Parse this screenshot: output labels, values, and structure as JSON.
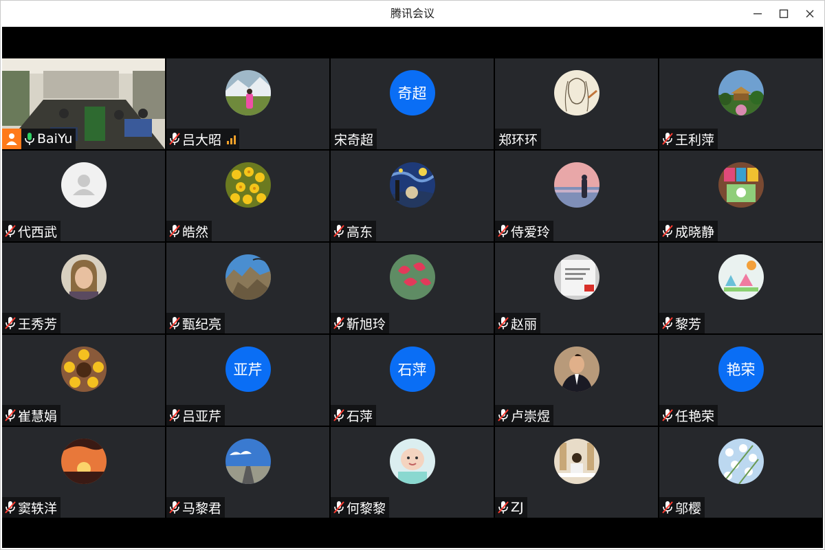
{
  "window": {
    "title": "腾讯会议"
  },
  "colors": {
    "accent_blue": "#0a6ef5",
    "tile_bg": "#26282c",
    "host_orange": "#ff7a1a",
    "signal": "#f2a12a",
    "active_border": "#27c15b"
  },
  "participants": [
    {
      "name": "BaiYu",
      "mic": "on",
      "host": true,
      "video": true,
      "avatar": "video-meeting-room"
    },
    {
      "name": "吕大昭",
      "mic": "muted",
      "signal": true,
      "avatar": "photo-girl-field"
    },
    {
      "name": "宋奇超",
      "mic": "none",
      "avatar_text": "奇超"
    },
    {
      "name": "郑环环",
      "mic": "none",
      "avatar": "sketch-portrait"
    },
    {
      "name": "王利萍",
      "mic": "muted",
      "avatar": "photo-garden-pavilion"
    },
    {
      "name": "代西武",
      "mic": "muted",
      "avatar": "default-user"
    },
    {
      "name": "皓然",
      "mic": "muted",
      "avatar": "photo-yellow-flowers"
    },
    {
      "name": "高东",
      "mic": "muted",
      "avatar": "starry-night-painting"
    },
    {
      "name": "侍爱玲",
      "mic": "muted",
      "avatar": "photo-beach-sunset"
    },
    {
      "name": "成晓静",
      "mic": "muted",
      "avatar": "photo-colorful-cartoon"
    },
    {
      "name": "王秀芳",
      "mic": "muted",
      "avatar": "photo-woman-portrait"
    },
    {
      "name": "甄纪亮",
      "mic": "muted",
      "avatar": "photo-mountain-sky"
    },
    {
      "name": "靳旭玲",
      "mic": "muted",
      "avatar": "photo-red-flowers"
    },
    {
      "name": "赵丽",
      "mic": "muted",
      "avatar": "photo-book-cover"
    },
    {
      "name": "黎芳",
      "mic": "muted",
      "avatar": "photo-child-drawing"
    },
    {
      "name": "崔慧娟",
      "mic": "muted",
      "avatar": "photo-sunflower"
    },
    {
      "name": "吕亚芹",
      "mic": "muted",
      "avatar_text": "亚芹"
    },
    {
      "name": "石萍",
      "mic": "muted",
      "avatar_text": "石萍"
    },
    {
      "name": "卢崇煜",
      "mic": "muted",
      "avatar": "photo-man-suit"
    },
    {
      "name": "任艳荣",
      "mic": "muted",
      "avatar_text": "艳荣"
    },
    {
      "name": "窦轶洋",
      "mic": "muted",
      "avatar": "photo-sunset-tree"
    },
    {
      "name": "马黎君",
      "mic": "muted",
      "avatar": "photo-blue-sky-road"
    },
    {
      "name": "何黎黎",
      "mic": "muted",
      "avatar": "photo-baby"
    },
    {
      "name": "ZJ",
      "mic": "muted",
      "avatar": "photo-woman-restaurant"
    },
    {
      "name": "邬樱",
      "mic": "muted",
      "avatar": "photo-white-blossoms"
    }
  ]
}
